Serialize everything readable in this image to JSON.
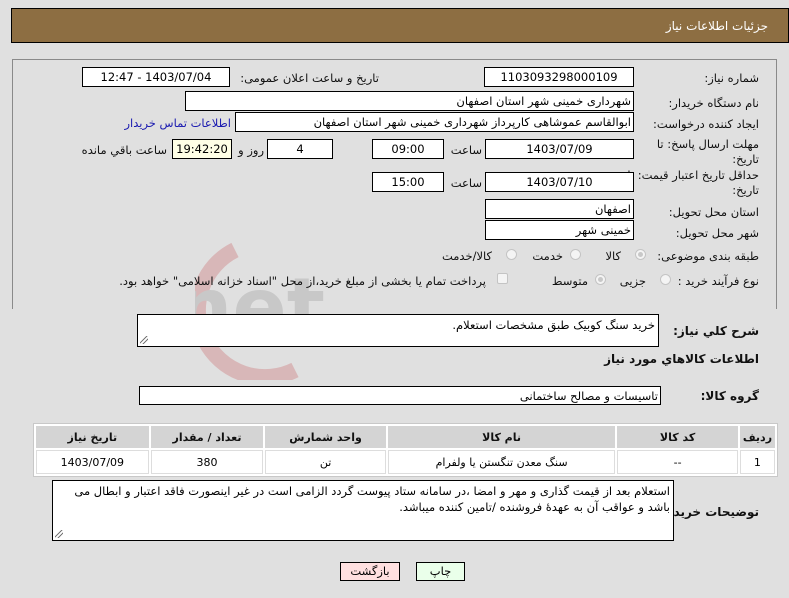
{
  "header": {
    "title": "جزئیات اطلاعات نیاز"
  },
  "fields": {
    "need_number": {
      "label": "شماره نیاز:",
      "value": "1103093298000109"
    },
    "announce_datetime": {
      "label": "تاریخ و ساعت اعلان عمومی:",
      "value": "1403/07/04 - 12:47"
    },
    "buyer_org": {
      "label": "نام دستگاه خریدار:",
      "value": "شهرداری خمینی شهر استان اصفهان"
    },
    "requester": {
      "label": "ایجاد کننده درخواست:",
      "value": "ابوالقاسم عموشاهی کارپرداز شهرداری خمینی شهر استان اصفهان"
    },
    "buyer_contact_link": "اطلاعات تماس خریدار",
    "response_deadline": {
      "label": "مهلت ارسال پاسخ: تا تاریخ:",
      "date": "1403/07/09",
      "time_label": "ساعت",
      "time": "09:00",
      "days": "4",
      "days_label": "روز و",
      "remaining": "19:42:20",
      "remaining_label": "ساعت باقي مانده"
    },
    "price_validity": {
      "label": "حداقل تاریخ اعتبار قیمت: تا تاریخ:",
      "date": "1403/07/10",
      "time_label": "ساعت",
      "time": "15:00"
    },
    "delivery_province": {
      "label": "استان محل تحویل:",
      "value": "اصفهان"
    },
    "delivery_city": {
      "label": "شهر محل تحویل:",
      "value": "خمینی شهر"
    },
    "category": {
      "label": "طبقه بندی موضوعی:",
      "options": [
        "کالا",
        "خدمت",
        "کالا/خدمت"
      ],
      "selected": "کالا"
    },
    "purchase_type": {
      "label": "نوع فرآیند خرید :",
      "options": [
        "جزیی",
        "متوسط"
      ],
      "selected": "متوسط",
      "checkbox_label": "پرداخت تمام یا بخشی از مبلغ خرید،از محل \"اسناد خزانه اسلامی\" خواهد بود.",
      "checkbox_checked": false
    }
  },
  "summary": {
    "label": "شرح کلي نياز:",
    "value": "خرید سنگ کوبیک طبق مشخصات استعلام."
  },
  "goods_section_title": "اطلاعات کالاهاي مورد نياز",
  "goods_group": {
    "label": "گروه کالا:",
    "value": "تاسیسات و مصالح ساختمانی"
  },
  "table": {
    "columns": [
      "ردیف",
      "کد کالا",
      "نام کالا",
      "واحد شمارش",
      "تعداد / مقدار",
      "تاریخ نیاز"
    ],
    "rows": [
      [
        "1",
        "--",
        "سنگ معدن تنگستن یا ولفرام",
        "تن",
        "380",
        "1403/07/09"
      ]
    ]
  },
  "buyer_notes": {
    "label": "توضیحات خریدار:",
    "value": "استعلام بعد از قیمت گذاری و مهر و امضا ،در سامانه ستاد پیوست گردد الزامی است در غیر اینصورت فاقد اعتبار و ابطال می باشد و عواقب آن به عهدهٔ فروشنده /تامین کننده میباشد."
  },
  "buttons": {
    "print": "چاپ",
    "back": "بازگشت"
  },
  "colors": {
    "header_bg": "#8d6e42",
    "print_bg": "#eaffea",
    "back_bg": "#ffe0e0",
    "link": "#1a1ab0"
  },
  "watermark": "AriaTender.net"
}
